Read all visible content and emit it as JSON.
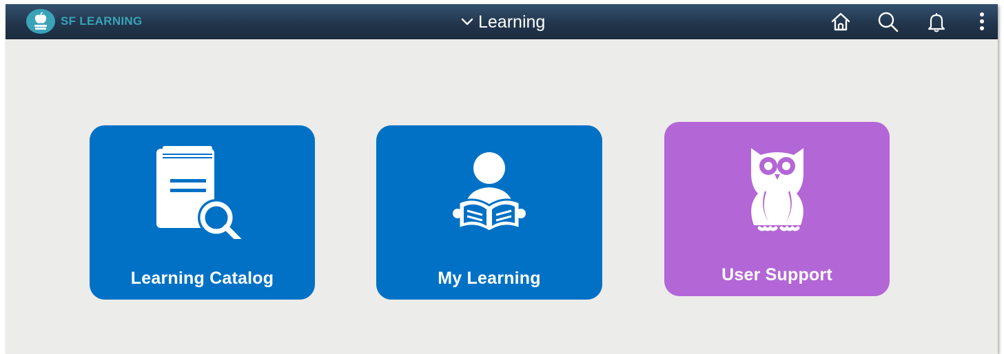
{
  "header": {
    "brand": "SF LEARNING",
    "title": "Learning",
    "icons": [
      "apple-book-logo-icon",
      "chevron-down-icon",
      "home-icon",
      "search-icon",
      "bell-icon",
      "more-vertical-icon"
    ]
  },
  "tiles": [
    {
      "label": "Learning Catalog",
      "icon": "book-search-icon",
      "color": "#0071c5"
    },
    {
      "label": "My Learning",
      "icon": "person-reading-icon",
      "color": "#0071c5"
    },
    {
      "label": "User Support",
      "icon": "owl-icon",
      "color": "#b366d6"
    }
  ],
  "colors": {
    "header_bg": "#22364d",
    "brand": "#3aa3b8",
    "page_bg": "#ececeb"
  }
}
